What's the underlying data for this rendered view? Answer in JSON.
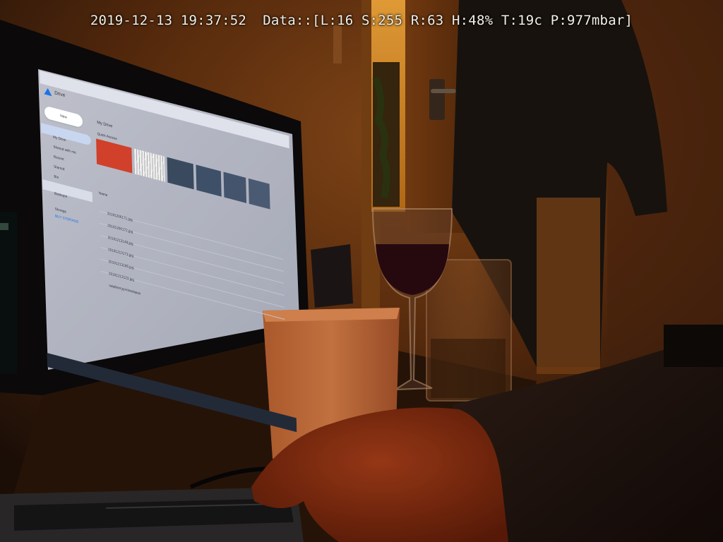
{
  "overlay": {
    "datetime": "2019-12-13 19:37:52",
    "data_prefix": "Data::",
    "light": "L:16",
    "saturation": "S:255",
    "red": "R:63",
    "humidity": "H:48%",
    "temperature": "T:19c",
    "pressure": "P:977mbar"
  },
  "monitor": {
    "app_name": "Drive",
    "new_button": "New",
    "sidebar_items": [
      "My Drive",
      "Shared with me",
      "Recent",
      "Starred",
      "Bin",
      "Backups",
      "Storage"
    ],
    "storage_upgrade": "BUY STORAGE",
    "breadcrumb": "My Drive",
    "quick_access_label": "Quick Access",
    "list_header": "Name",
    "files": [
      "20191206171.jpg",
      "20191206172.jpg",
      "20191213148.jpg",
      "20191213173.jpg",
      "20191213185.jpg",
      "20191213123.jpg",
      "raspberrypi-timelapse"
    ]
  },
  "colors": {
    "overlay_text": "#f4f0e6",
    "wall": "#6a3510",
    "doorway_light": "#f0a030",
    "screen": "#e6e8f0",
    "drive_accent": "#1a73e8"
  }
}
